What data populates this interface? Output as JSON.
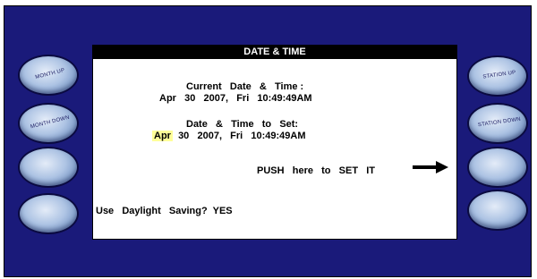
{
  "panel": {
    "title": "DATE & TIME",
    "current_label": "Current   Date   &   Time :",
    "current_value": "Apr   30   2007,   Fri   10:49:49AM",
    "set_label": "Date   &   Time   to   Set:",
    "set_month": "Apr",
    "set_value_rest": "  30   2007,   Fri   10:49:49AM",
    "push_text": "PUSH   here   to   SET   IT",
    "daylight_text": "Use   Daylight   Saving?  YES"
  },
  "left_buttons": [
    {
      "label": "MONTH UP"
    },
    {
      "label": "MONTH DOWN"
    },
    {
      "label": ""
    },
    {
      "label": ""
    }
  ],
  "right_buttons": [
    {
      "label": "STATION UP"
    },
    {
      "label": "STATION DOWN"
    },
    {
      "label": ""
    },
    {
      "label": ""
    }
  ],
  "colors": {
    "frame": "#1a1a7a",
    "highlight": "#ffff99",
    "title_bar": "#000000"
  },
  "icons": {
    "push_arrow": "right-arrow-icon"
  }
}
